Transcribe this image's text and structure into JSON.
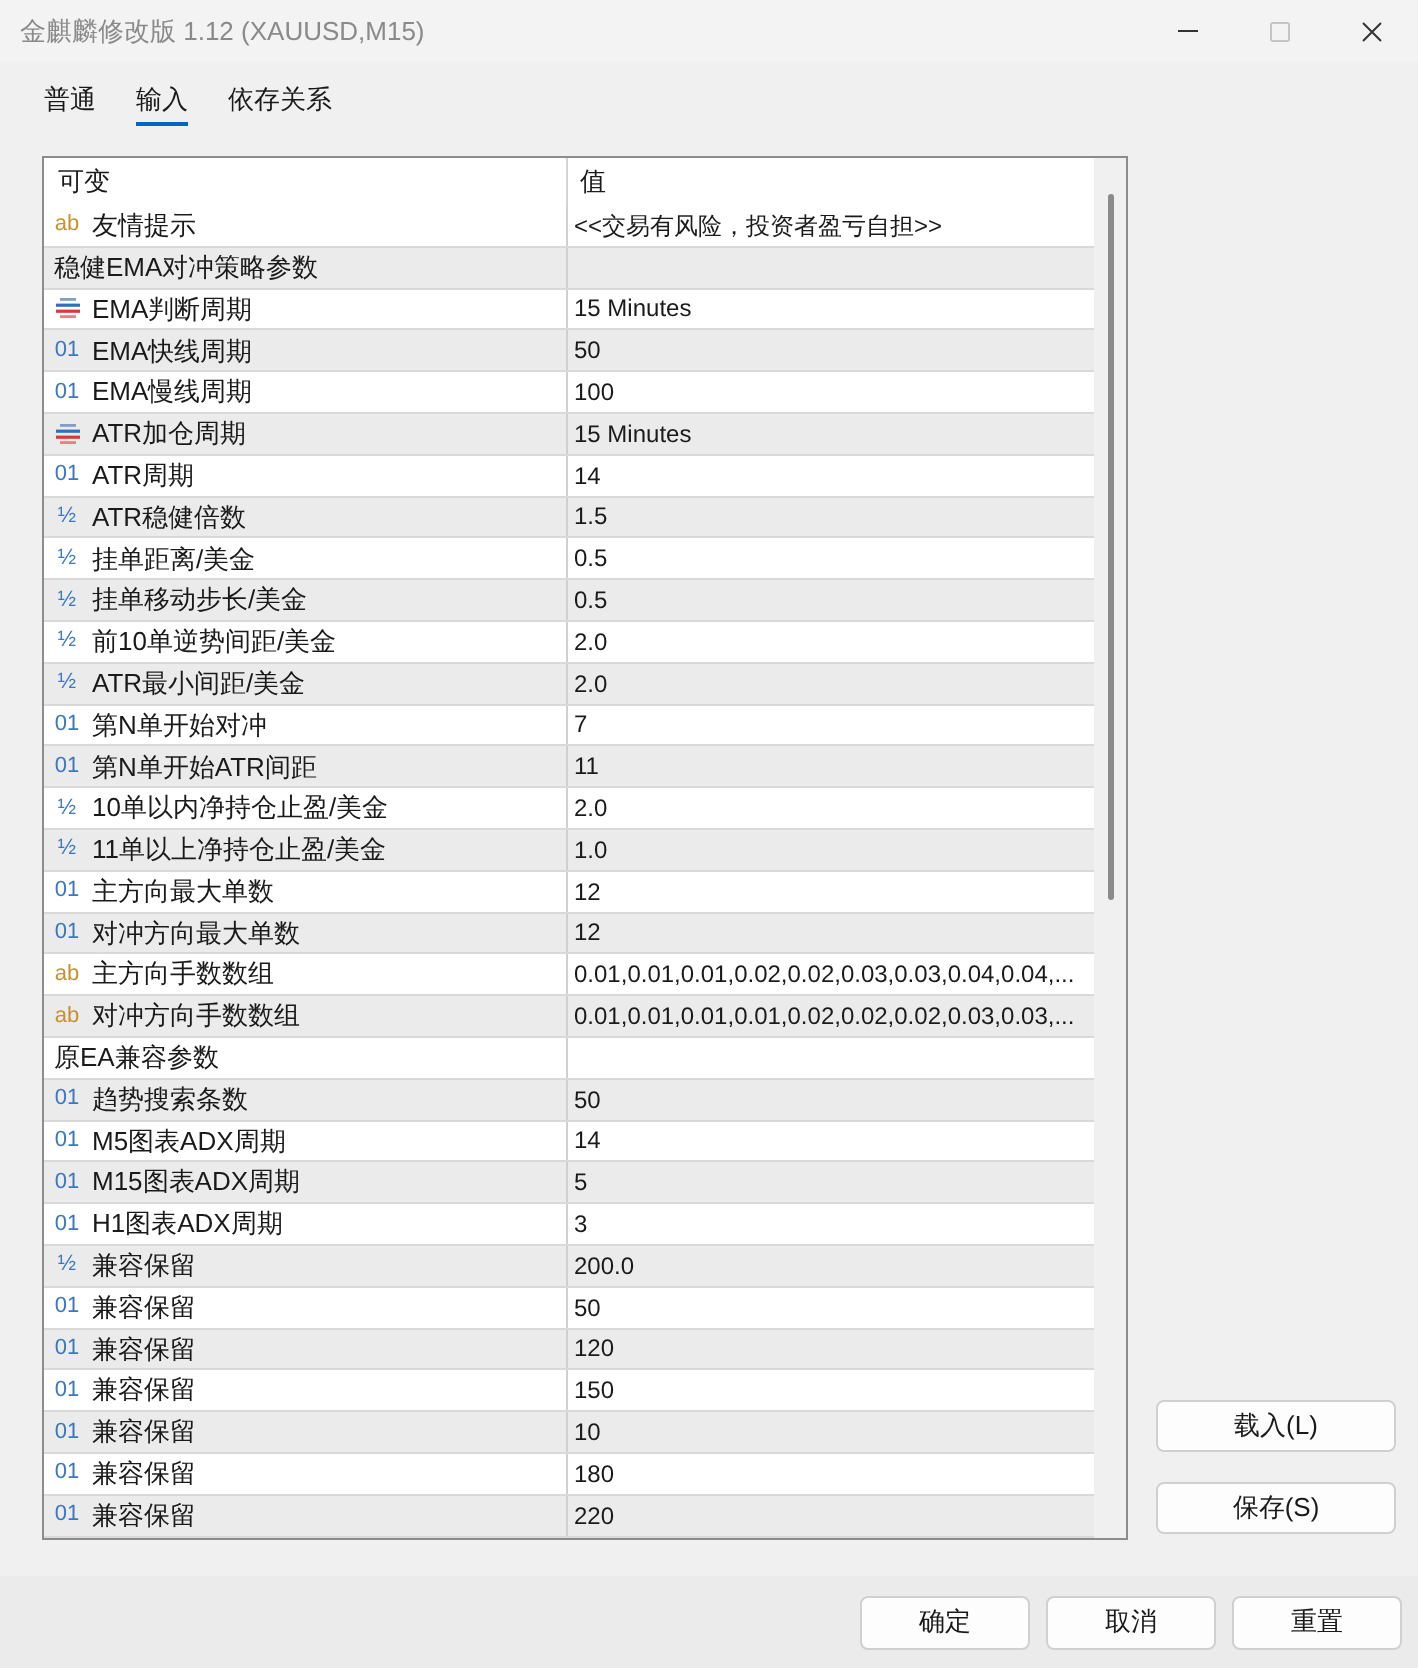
{
  "window": {
    "title": "金麒麟修改版 1.12 (XAUUSD,M15)",
    "controls": [
      {
        "kind": "minimize",
        "disabled": false
      },
      {
        "kind": "maximize",
        "disabled": true
      },
      {
        "kind": "close",
        "disabled": false
      }
    ]
  },
  "tabs": [
    {
      "label": "普通",
      "selected": false
    },
    {
      "label": "输入",
      "selected": true
    },
    {
      "label": "依存关系",
      "selected": false
    }
  ],
  "table": {
    "columns": [
      "可变",
      "值"
    ],
    "rows": [
      {
        "kind": "string",
        "icon": "ab",
        "name": "友情提示",
        "value": "<<交易有风险，投资者盈亏自担>>"
      },
      {
        "kind": "group",
        "name": "稳健EMA对冲策略参数"
      },
      {
        "kind": "enum",
        "name": "EMA判断周期",
        "value": "15 Minutes"
      },
      {
        "kind": "integer",
        "icon": "01",
        "name": "EMA快线周期",
        "value": "50"
      },
      {
        "kind": "integer",
        "icon": "01",
        "name": "EMA慢线周期",
        "value": "100"
      },
      {
        "kind": "enum",
        "name": "ATR加仓周期",
        "value": "15 Minutes"
      },
      {
        "kind": "integer",
        "icon": "01",
        "name": "ATR周期",
        "value": "14"
      },
      {
        "kind": "double",
        "icon": "½",
        "name": "ATR稳健倍数",
        "value": "1.5"
      },
      {
        "kind": "double",
        "icon": "½",
        "name": "挂单距离/美金",
        "value": "0.5"
      },
      {
        "kind": "double",
        "icon": "½",
        "name": "挂单移动步长/美金",
        "value": "0.5"
      },
      {
        "kind": "double",
        "icon": "½",
        "name": "前10单逆势间距/美金",
        "value": "2.0"
      },
      {
        "kind": "double",
        "icon": "½",
        "name": "ATR最小间距/美金",
        "value": "2.0"
      },
      {
        "kind": "integer",
        "icon": "01",
        "name": "第N单开始对冲",
        "value": "7"
      },
      {
        "kind": "integer",
        "icon": "01",
        "name": "第N单开始ATR间距",
        "value": "11"
      },
      {
        "kind": "double",
        "icon": "½",
        "name": "10单以内净持仓止盈/美金",
        "value": "2.0"
      },
      {
        "kind": "double",
        "icon": "½",
        "name": "11单以上净持仓止盈/美金",
        "value": "1.0"
      },
      {
        "kind": "integer",
        "icon": "01",
        "name": "主方向最大单数",
        "value": "12"
      },
      {
        "kind": "integer",
        "icon": "01",
        "name": "对冲方向最大单数",
        "value": "12"
      },
      {
        "kind": "string",
        "icon": "ab",
        "name": "主方向手数数组",
        "value": "0.01,0.01,0.01,0.02,0.02,0.03,0.03,0.04,0.04,..."
      },
      {
        "kind": "string",
        "icon": "ab",
        "name": "对冲方向手数数组",
        "value": "0.01,0.01,0.01,0.01,0.02,0.02,0.02,0.03,0.03,..."
      },
      {
        "kind": "group",
        "name": "原EA兼容参数"
      },
      {
        "kind": "integer",
        "icon": "01",
        "name": "趋势搜索条数",
        "value": "50"
      },
      {
        "kind": "integer",
        "icon": "01",
        "name": "M5图表ADX周期",
        "value": "14"
      },
      {
        "kind": "integer",
        "icon": "01",
        "name": "M15图表ADX周期",
        "value": "5"
      },
      {
        "kind": "integer",
        "icon": "01",
        "name": "H1图表ADX周期",
        "value": "3"
      },
      {
        "kind": "double",
        "icon": "½",
        "name": "兼容保留",
        "value": "200.0"
      },
      {
        "kind": "integer",
        "icon": "01",
        "name": "兼容保留",
        "value": "50"
      },
      {
        "kind": "integer",
        "icon": "01",
        "name": "兼容保留",
        "value": "120"
      },
      {
        "kind": "integer",
        "icon": "01",
        "name": "兼容保留",
        "value": "150"
      },
      {
        "kind": "integer",
        "icon": "01",
        "name": "兼容保留",
        "value": "10"
      },
      {
        "kind": "integer",
        "icon": "01",
        "name": "兼容保留",
        "value": "180"
      },
      {
        "kind": "integer",
        "icon": "01",
        "name": "兼容保留",
        "value": "220"
      }
    ]
  },
  "side_buttons": [
    "载入(L)",
    "保存(S)"
  ],
  "footer_buttons": [
    "确定",
    "取消",
    "重置"
  ]
}
